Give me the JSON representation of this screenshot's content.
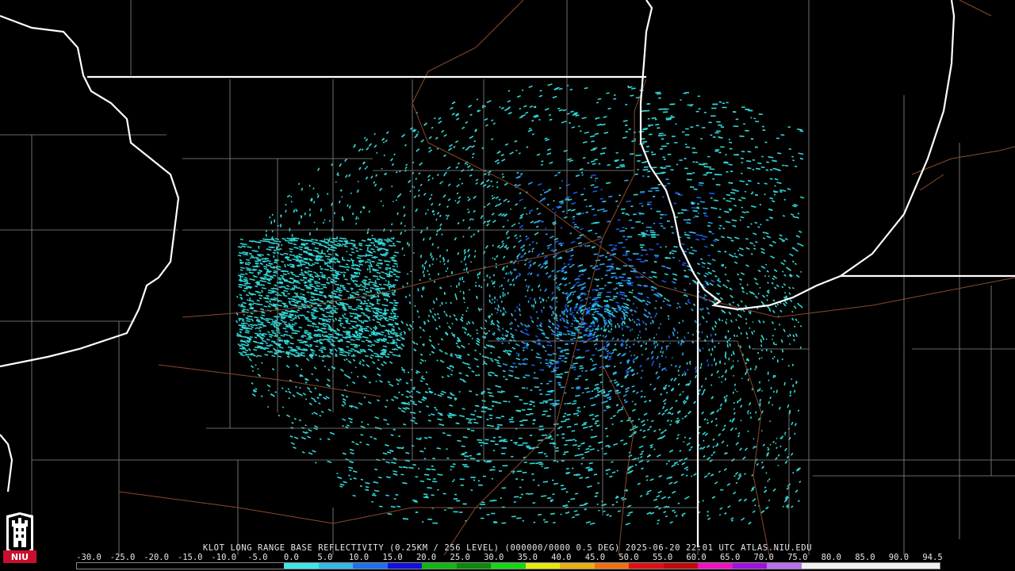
{
  "caption": "KLOT LONG RANGE BASE REFLECTIVITY (0.25KM / 256 LEVEL) (000000/0000 0.5 DEG) 2025-06-20 22:01 UTC  ATLAS.NIU.EDU",
  "logo_text": "NIU",
  "scale": {
    "labels": [
      "-30.0",
      "-25.0",
      "-20.0",
      "-15.0",
      "-10.0",
      "-5.0",
      "0.0",
      "5.0",
      "10.0",
      "15.0",
      "20.0",
      "25.0",
      "30.0",
      "35.0",
      "40.0",
      "45.0",
      "50.0",
      "55.0",
      "60.0",
      "65.0",
      "70.0",
      "75.0",
      "80.0",
      "85.0",
      "90.0",
      "94.5"
    ],
    "colors": [
      "#000000",
      "#000000",
      "#000000",
      "#000000",
      "#000000",
      "#000000",
      "#3fe6e6",
      "#35b8ea",
      "#1f6ff0",
      "#1010e0",
      "#10b810",
      "#0a8a0a",
      "#14d814",
      "#e8e810",
      "#e8b010",
      "#f07010",
      "#e01010",
      "#c00808",
      "#f010c0",
      "#a010e0",
      "#b870f0",
      "#f0f0f0",
      "#f0f0f0",
      "#f0f0f0",
      "#f0f0f0"
    ]
  },
  "colors": {
    "state_line": "#ffffff",
    "county_line": "#8a8a8a",
    "road_line": "#8a4a2a",
    "echo_light": "#33d6d6",
    "echo_mid": "#2a9ee6",
    "echo_strong": "#1a55e0"
  },
  "icons": [
    "niu-logo-icon"
  ]
}
